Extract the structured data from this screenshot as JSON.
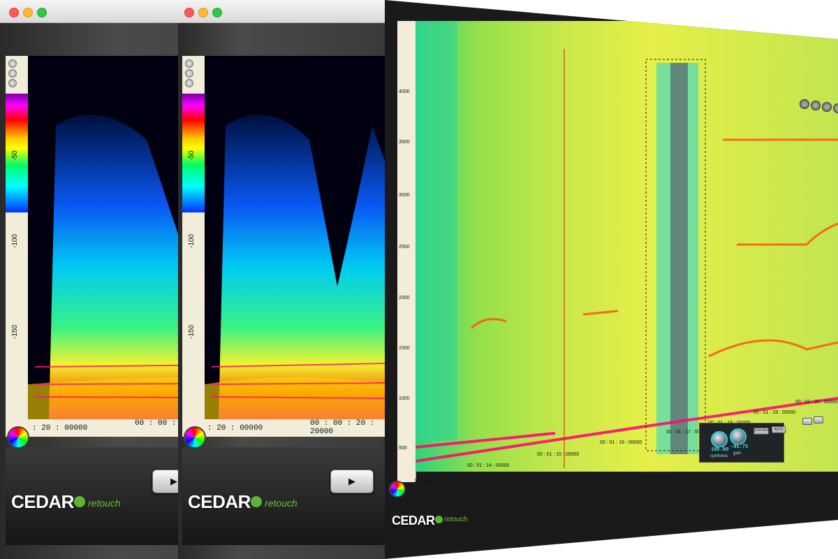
{
  "windows": [
    {
      "brand": "CEDAR",
      "brand_sub": "retouch",
      "scale_labels": [
        "-50",
        "-100",
        "-150",
        "-100"
      ],
      "time_left": ": 20 : 00000",
      "time_right": "00 : 00 : 20 : 20000",
      "play_label": "▶"
    },
    {
      "brand": "CEDAR",
      "brand_sub": "retouch",
      "scale_labels": [
        "-50",
        "-100",
        "-150",
        "-100"
      ],
      "time_left": ": 20 : 00000",
      "time_right": "00 : 00 : 20 : 20000",
      "play_label": "▶"
    }
  ],
  "main_window": {
    "brand": "CEDAR",
    "brand_sub": "retouch",
    "freq_labels": [
      "4000",
      "3500",
      "3000",
      "2500",
      "2000",
      "1500",
      "1000",
      "500"
    ],
    "time_labels": [
      "13 : 00000",
      "00 : 01 : 14 : 00000",
      "00 : 01 : 15 : 00000",
      "00 : 01 : 16 : 00000",
      "00 : 01 : 17 : 00000",
      "00 : 01 : 18 : 00000",
      "00 : 01 : 19 : 00000",
      "00 : 01 : 20 : 00000"
    ],
    "knob1_value": "100.00",
    "knob1_label": "synthesis",
    "knob2_value": "-05.75",
    "knob2_label": "gain",
    "section_label": "interpolate",
    "buttons": [
      "preview",
      "apply"
    ]
  },
  "colors": {
    "frame_dark": "#2a2a2a",
    "panel_cream": "#f2edd8",
    "brand_green": "#5fb530",
    "accent_cyan": "#1fd0e0"
  }
}
